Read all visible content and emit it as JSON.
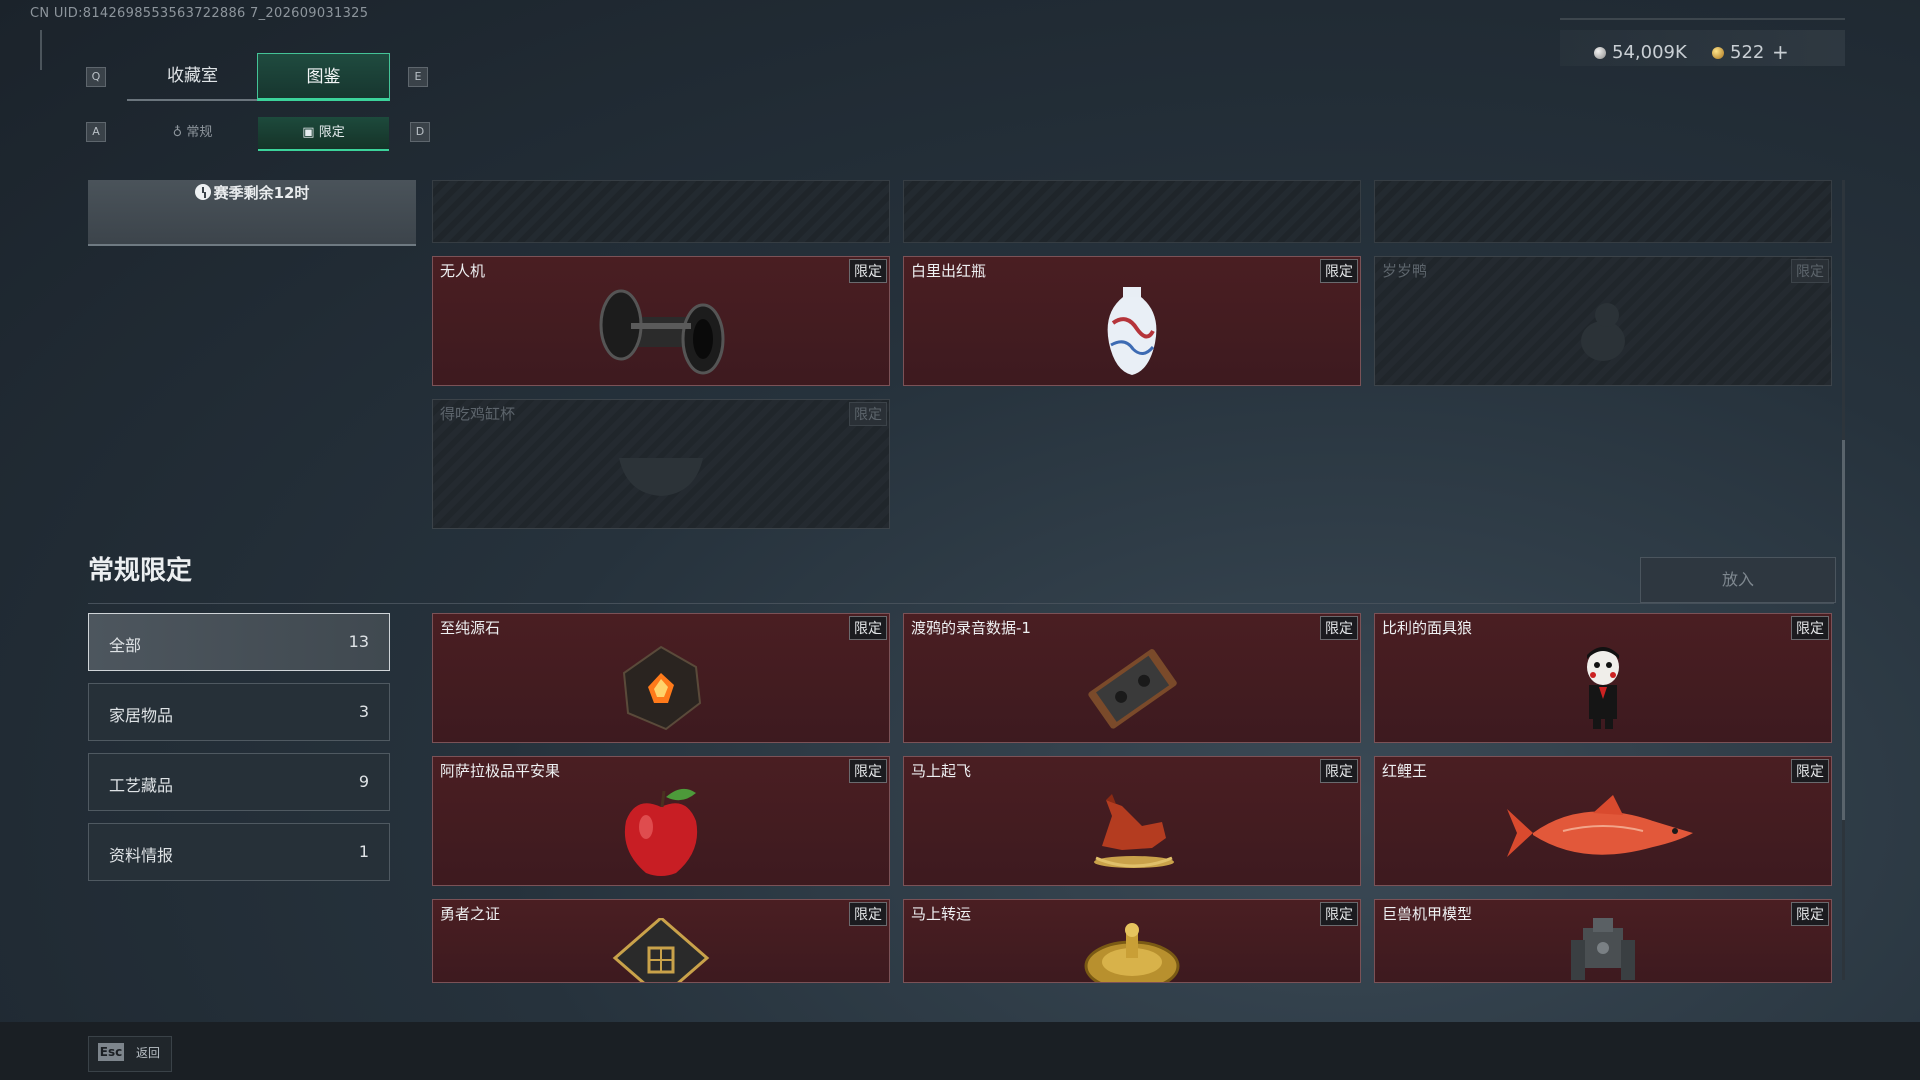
{
  "uid": "CN UID:8142698553563722886 7_202609031325",
  "tabs": {
    "q_key": "Q",
    "e_key": "E",
    "main": [
      {
        "label": "收藏室"
      },
      {
        "label": "图鉴"
      }
    ],
    "a_key": "A",
    "d_key": "D",
    "sub": [
      {
        "label": "常规"
      },
      {
        "label": "限定"
      }
    ]
  },
  "currency": {
    "silver": "54,009K",
    "gold": "522",
    "plus": "+"
  },
  "season": {
    "remaining": "赛季剩余12时"
  },
  "limited_cards": [
    {
      "name": "无人机",
      "tag": "限定",
      "icon": "drone-part-icon",
      "locked": false
    },
    {
      "name": "白里出红瓶",
      "tag": "限定",
      "icon": "porcelain-vase-icon",
      "locked": false
    },
    {
      "name": "岁岁鸭",
      "tag": "限定",
      "icon": "duck-icon",
      "locked": true
    },
    {
      "name": "得吃鸡缸杯",
      "tag": "限定",
      "icon": "cup-icon",
      "locked": true
    }
  ],
  "section": {
    "title": "常规限定",
    "put_button": "放入"
  },
  "categories": [
    {
      "label": "全部",
      "count": "13"
    },
    {
      "label": "家居物品",
      "count": "3"
    },
    {
      "label": "工艺藏品",
      "count": "9"
    },
    {
      "label": "资料情报",
      "count": "1"
    }
  ],
  "regular_cards": [
    {
      "name": "至纯源石",
      "tag": "限定",
      "icon": "crystal-stone-icon"
    },
    {
      "name": "渡鸦的录音数据-1",
      "tag": "限定",
      "icon": "cassette-tape-icon"
    },
    {
      "name": "比利的面具狼",
      "tag": "限定",
      "icon": "billy-puppet-icon"
    },
    {
      "name": "阿萨拉极品平安果",
      "tag": "限定",
      "icon": "apple-icon"
    },
    {
      "name": "马上起飞",
      "tag": "限定",
      "icon": "horse-statue-icon"
    },
    {
      "name": "红鲤王",
      "tag": "限定",
      "icon": "koi-fish-icon"
    },
    {
      "name": "勇者之证",
      "tag": "限定",
      "icon": "badge-icon"
    },
    {
      "name": "马上转运",
      "tag": "限定",
      "icon": "golden-dial-icon"
    },
    {
      "name": "巨兽机甲模型",
      "tag": "限定",
      "icon": "mech-model-icon"
    }
  ],
  "footer": {
    "esc_key": "Esc",
    "esc_label": "返回"
  },
  "colors": {
    "accent": "#3cd39b",
    "card_bg": "#4a1e22",
    "locked_bg": "#242a30"
  }
}
